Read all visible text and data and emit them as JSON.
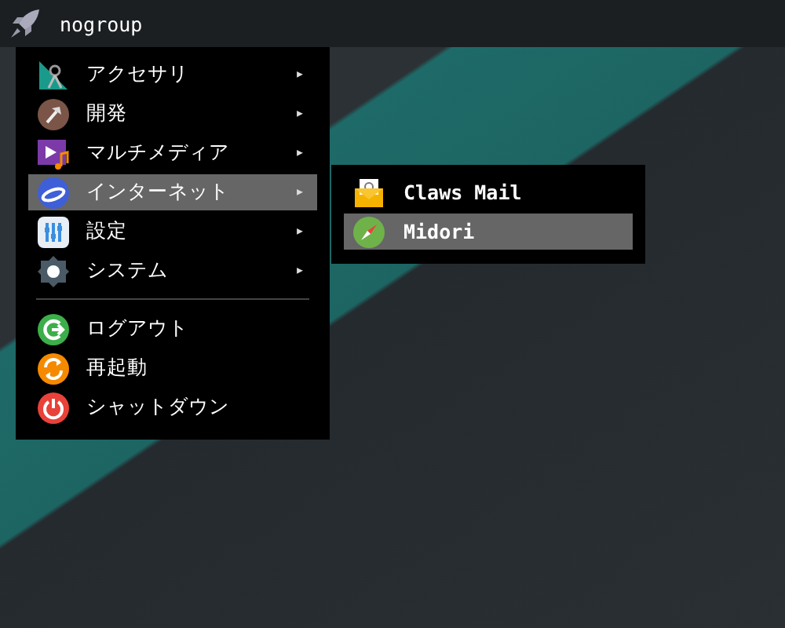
{
  "panel": {
    "title": "nogroup"
  },
  "menu": {
    "items": [
      {
        "kind": "submenu",
        "label": "アクセサリ",
        "arrow": "▸",
        "selected": false
      },
      {
        "kind": "submenu",
        "label": "開発",
        "arrow": "▸",
        "selected": false
      },
      {
        "kind": "submenu",
        "label": "マルチメディア",
        "arrow": "▸",
        "selected": false
      },
      {
        "kind": "submenu",
        "label": "インターネット",
        "arrow": "▸",
        "selected": true
      },
      {
        "kind": "submenu",
        "label": "設定",
        "arrow": "▸",
        "selected": false
      },
      {
        "kind": "submenu",
        "label": "システム",
        "arrow": "▸",
        "selected": false
      },
      {
        "kind": "separator"
      },
      {
        "kind": "action",
        "label": "ログアウト",
        "selected": false
      },
      {
        "kind": "action",
        "label": "再起動",
        "selected": false
      },
      {
        "kind": "action",
        "label": "シャットダウン",
        "selected": false
      }
    ]
  },
  "submenu": {
    "items": [
      {
        "kind": "action",
        "label": "Claws Mail",
        "selected": false
      },
      {
        "kind": "action",
        "label": "Midori",
        "selected": true
      }
    ]
  }
}
